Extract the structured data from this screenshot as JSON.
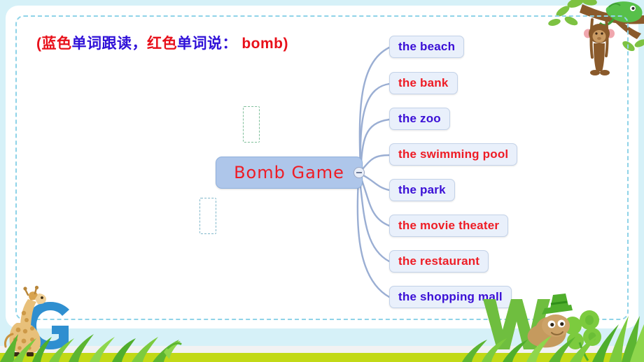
{
  "slide": {
    "background_color": "#d6f1f8",
    "accent_lime": "#c2d916"
  },
  "title": {
    "segments": [
      {
        "text": "(蓝色",
        "color": "#e8101a"
      },
      {
        "text": "单词跟读，",
        "color": "#2f10d8"
      },
      {
        "text": "红色",
        "color": "#e8101a"
      },
      {
        "text": "单词说：",
        "color": "#2f10d8"
      },
      {
        "text": " bomb)",
        "color": "#e8101a"
      }
    ]
  },
  "mindmap": {
    "center": {
      "label": "Bomb  Game",
      "text_color": "#ee1c25",
      "fill_color": "#aec6ea",
      "collapse_icon": "minus-circle-icon"
    },
    "branches": [
      {
        "label": "the beach",
        "color": "#3a0fd6",
        "mode": "repeat"
      },
      {
        "label": "the bank",
        "color": "#ee1c25",
        "mode": "bomb"
      },
      {
        "label": "the zoo",
        "color": "#3a0fd6",
        "mode": "repeat"
      },
      {
        "label": "the swimming pool",
        "color": "#ee1c25",
        "mode": "bomb"
      },
      {
        "label": "the park",
        "color": "#3a0fd6",
        "mode": "repeat"
      },
      {
        "label": "the movie theater",
        "color": "#ee1c25",
        "mode": "bomb"
      },
      {
        "label": "the restaurant",
        "color": "#ee1c25",
        "mode": "bomb"
      },
      {
        "label": "the shopping mall",
        "color": "#3a0fd6",
        "mode": "repeat"
      }
    ],
    "placeholders": [
      "",
      ""
    ]
  },
  "decorations": {
    "monkey": "monkey-icon",
    "chameleon": "chameleon-icon",
    "branch": "tree-branch-icon",
    "giraffe": "giraffe-icon",
    "letter_g": "G",
    "letter_w": "W",
    "worm": "worm-icon",
    "grass": "grass-icon",
    "clover": "clover-icon"
  }
}
